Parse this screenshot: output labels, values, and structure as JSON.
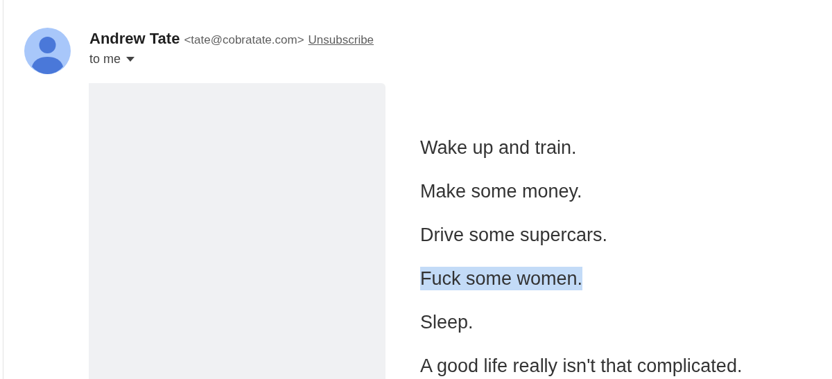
{
  "sender": {
    "name": "Andrew Tate",
    "address": "<tate@cobratate.com>",
    "unsubscribe": "Unsubscribe",
    "recipient": "to me"
  },
  "body": {
    "image": {
      "kind": "placeholder"
    },
    "lines": [
      {
        "text": "Wake up and train.",
        "selected": false
      },
      {
        "text": "Make some money.",
        "selected": false
      },
      {
        "text": "Drive some supercars.",
        "selected": false
      },
      {
        "text": "Fuck some women.",
        "selected": true
      },
      {
        "text": "Sleep.",
        "selected": false
      },
      {
        "text": "A good life really isn't that complicated.",
        "selected": false
      }
    ]
  }
}
